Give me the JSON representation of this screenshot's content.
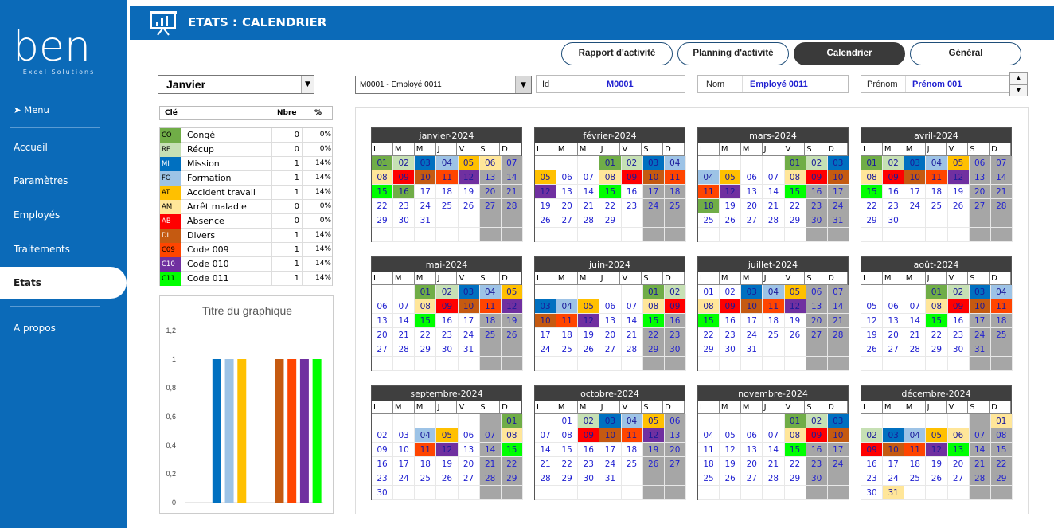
{
  "sidebar": {
    "brand": "ben",
    "brand_sub": "Excel Solutions",
    "menu_label": "Menu",
    "items": [
      "Accueil",
      "Paramètres",
      "Employés",
      "Traitements",
      "Etats",
      "A propos"
    ],
    "active": "Etats"
  },
  "header": {
    "title": "ETATS :",
    "subtitle": "CALENDRIER"
  },
  "tabs": [
    {
      "label": "Rapport d'activité",
      "active": false
    },
    {
      "label": "Planning d'activité",
      "active": false
    },
    {
      "label": "Calendrier",
      "active": true
    },
    {
      "label": "Général",
      "active": false
    }
  ],
  "month_select": {
    "value": "Janvier"
  },
  "employee_select": {
    "value": "M0001 - Employé 0011"
  },
  "fields": {
    "id_label": "Id",
    "id_value": "M0001",
    "nom_label": "Nom",
    "nom_value": "Employé 0011",
    "prenom_label": "Prénom",
    "prenom_value": "Prénom 001"
  },
  "legend": {
    "head_cle": "Clé",
    "head_nbre": "Nbre",
    "head_pct": "%",
    "rows": [
      {
        "code": "CO",
        "label": "Congé",
        "count": "0",
        "pct": "0%",
        "color": "#70ad47"
      },
      {
        "code": "RE",
        "label": "Récup",
        "count": "0",
        "pct": "0%",
        "color": "#c6e0b4"
      },
      {
        "code": "MI",
        "label": "Mission",
        "count": "1",
        "pct": "14%",
        "color": "#0070c0"
      },
      {
        "code": "FO",
        "label": "Formation",
        "count": "1",
        "pct": "14%",
        "color": "#9dc3e6"
      },
      {
        "code": "AT",
        "label": "Accident travail",
        "count": "1",
        "pct": "14%",
        "color": "#ffc000"
      },
      {
        "code": "AM",
        "label": "Arrêt maladie",
        "count": "0",
        "pct": "0%",
        "color": "#ffe699"
      },
      {
        "code": "AB",
        "label": "Absence",
        "count": "0",
        "pct": "0%",
        "color": "#ff0000"
      },
      {
        "code": "DI",
        "label": "Divers",
        "count": "1",
        "pct": "14%",
        "color": "#c55a11"
      },
      {
        "code": "C09",
        "label": "Code 009",
        "count": "1",
        "pct": "14%",
        "color": "#ff4500"
      },
      {
        "code": "C10",
        "label": "Code 010",
        "count": "1",
        "pct": "14%",
        "color": "#7030a0"
      },
      {
        "code": "C11",
        "label": "Code 011",
        "count": "1",
        "pct": "14%",
        "color": "#00ff00"
      }
    ]
  },
  "chart_data": {
    "type": "bar",
    "title": "Titre du graphique",
    "categories": [
      "CO",
      "RE",
      "MI",
      "FO",
      "AT",
      "AM",
      "AB",
      "DI",
      "C09",
      "C10",
      "C11"
    ],
    "values": [
      0,
      0,
      1,
      1,
      1,
      0,
      0,
      1,
      1,
      1,
      1
    ],
    "colors": [
      "#70ad47",
      "#c6e0b4",
      "#0070c0",
      "#9dc3e6",
      "#ffc000",
      "#ffe699",
      "#ff0000",
      "#c55a11",
      "#ff4500",
      "#7030a0",
      "#00ff00"
    ],
    "ylim": [
      0,
      1.2
    ],
    "yticks": [
      "0",
      "0,2",
      "0,4",
      "0,6",
      "0,8",
      "1",
      "1,2"
    ]
  },
  "calendar": {
    "day_headers": [
      "L",
      "M",
      "M",
      "J",
      "V",
      "S",
      "D"
    ],
    "months": [
      {
        "title": "janvier-2024",
        "offset": 0,
        "days": 31,
        "codes": {
          "1": "CO",
          "2": "RE",
          "3": "MI",
          "4": "FO",
          "5": "AT",
          "6": "AM",
          "8": "AM",
          "9": "AB",
          "10": "DI",
          "11": "C09",
          "12": "C10",
          "15": "C11",
          "16": "CO"
        }
      },
      {
        "title": "février-2024",
        "offset": 3,
        "days": 29,
        "codes": {
          "1": "CO",
          "2": "RE",
          "3": "MI",
          "4": "FO",
          "5": "AT",
          "8": "AM",
          "9": "AB",
          "10": "DI",
          "11": "C09",
          "12": "C10",
          "15": "C11"
        }
      },
      {
        "title": "mars-2024",
        "offset": 4,
        "days": 31,
        "codes": {
          "1": "CO",
          "2": "RE",
          "3": "MI",
          "4": "FO",
          "5": "AT",
          "8": "AM",
          "9": "AB",
          "10": "DI",
          "11": "C09",
          "12": "C10",
          "15": "C11",
          "18": "CO"
        }
      },
      {
        "title": "avril-2024",
        "offset": 0,
        "days": 30,
        "codes": {
          "1": "CO",
          "2": "RE",
          "3": "MI",
          "4": "FO",
          "5": "AT",
          "8": "AM",
          "9": "AB",
          "10": "DI",
          "11": "C09",
          "12": "C10",
          "15": "C11"
        }
      },
      {
        "title": "mai-2024",
        "offset": 2,
        "days": 31,
        "codes": {
          "1": "CO",
          "2": "RE",
          "3": "MI",
          "4": "FO",
          "5": "AT",
          "8": "AM",
          "9": "AB",
          "10": "DI",
          "11": "C09",
          "12": "C10",
          "15": "C11"
        }
      },
      {
        "title": "juin-2024",
        "offset": 5,
        "days": 30,
        "codes": {
          "1": "CO",
          "2": "RE",
          "3": "MI",
          "4": "FO",
          "5": "AT",
          "8": "AM",
          "9": "AB",
          "10": "DI",
          "11": "C09",
          "12": "C10",
          "15": "C11"
        }
      },
      {
        "title": "juillet-2024",
        "offset": 0,
        "days": 31,
        "codes": {
          "3": "MI",
          "4": "FO",
          "5": "AT",
          "8": "AM",
          "9": "AB",
          "10": "DI",
          "11": "C09",
          "12": "C10",
          "15": "C11"
        }
      },
      {
        "title": "août-2024",
        "offset": 3,
        "days": 31,
        "codes": {
          "1": "CO",
          "2": "RE",
          "3": "MI",
          "4": "FO",
          "8": "AM",
          "9": "AB",
          "10": "DI",
          "11": "C09",
          "15": "C11"
        }
      },
      {
        "title": "septembre-2024",
        "offset": 6,
        "days": 30,
        "codes": {
          "1": "CO",
          "4": "FO",
          "5": "AT",
          "8": "AM",
          "11": "C09",
          "12": "C10",
          "15": "C11"
        }
      },
      {
        "title": "octobre-2024",
        "offset": 1,
        "days": 31,
        "codes": {
          "2": "RE",
          "3": "MI",
          "4": "FO",
          "5": "AT",
          "9": "AB",
          "10": "DI",
          "11": "C09",
          "12": "C10"
        }
      },
      {
        "title": "novembre-2024",
        "offset": 4,
        "days": 30,
        "codes": {
          "1": "CO",
          "2": "RE",
          "3": "MI",
          "8": "AM",
          "9": "AB",
          "10": "DI",
          "15": "C11"
        }
      },
      {
        "title": "décembre-2024",
        "offset": 6,
        "days": 31,
        "codes": {
          "1": "AM",
          "2": "RE",
          "3": "MI",
          "4": "FO",
          "5": "AT",
          "6": "AM",
          "9": "AB",
          "10": "DI",
          "11": "C09",
          "12": "C10",
          "13": "C11",
          "31": "AM"
        }
      }
    ]
  }
}
